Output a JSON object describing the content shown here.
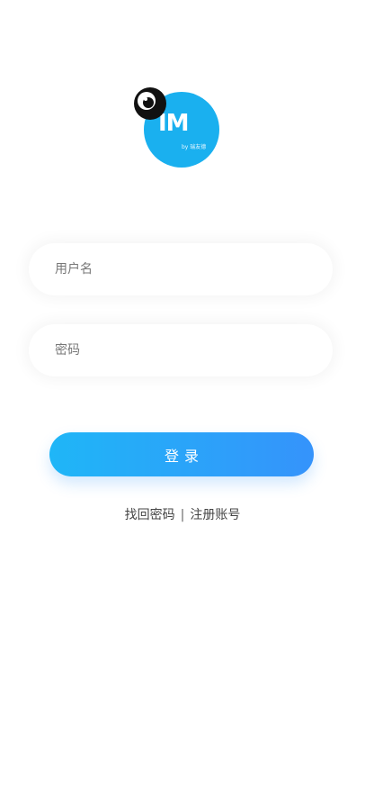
{
  "logo": {
    "mark_text": "IM",
    "sub_text": "by 瑞友德",
    "brand_color": "#1ab0ef"
  },
  "form": {
    "username_placeholder": "用户名",
    "username_value": "",
    "password_placeholder": "密码",
    "password_value": "",
    "login_label": "登录",
    "login_gradient": [
      "#1fb6f7",
      "#3593fb"
    ]
  },
  "links": {
    "forgot_password": "找回密码",
    "separator": "|",
    "register": "注册账号"
  },
  "icons": {
    "logo_mascot": "eyeball-icon"
  }
}
